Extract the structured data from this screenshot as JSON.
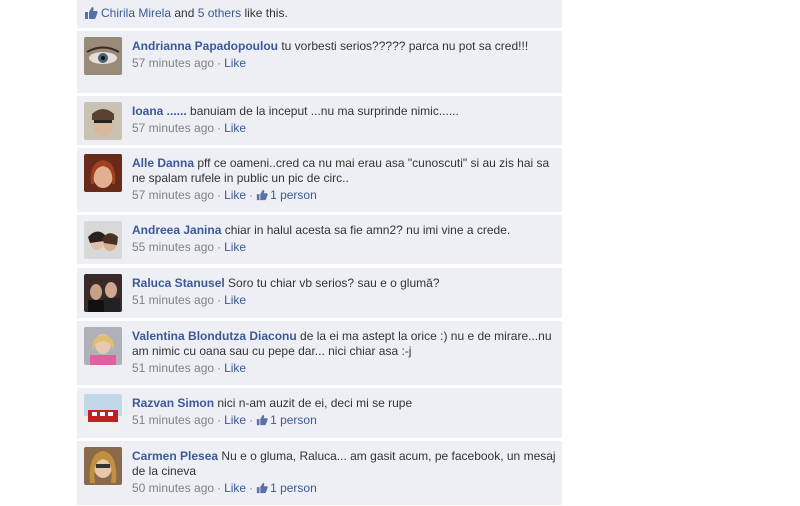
{
  "likes_bar": {
    "name": "Chirila Mirela",
    "and": "and",
    "others": "5 others",
    "suffix": "like this."
  },
  "comments": [
    {
      "author": "Andrianna Papadopoulou",
      "text": "tu vorbesti serios????? parca nu pot sa cred!!!",
      "time": "57 minutes ago",
      "like": "Like",
      "likes": ""
    },
    {
      "author": "Ioana ......",
      "text": "banuiam de la inceput ...nu ma surprinde nimic......",
      "time": "57 minutes ago",
      "like": "Like",
      "likes": ""
    },
    {
      "author": "Alle Danna",
      "text": "pff ce oameni..cred ca nu mai erau asa \"cunoscuti\" si au zis hai sa ne spalam rufele in public un pic de circ..",
      "time": "57 minutes ago",
      "like": "Like",
      "likes": "1 person"
    },
    {
      "author": "Andreea Janina",
      "text": "chiar in halul acesta sa fie amn2? nu imi vine a crede.",
      "time": "55 minutes ago",
      "like": "Like",
      "likes": ""
    },
    {
      "author": "Raluca Stanusel",
      "text": "Soro tu chiar vb serios? sau e o glumă?",
      "time": "51 minutes ago",
      "like": "Like",
      "likes": ""
    },
    {
      "author": "Valentina Blondutza Diaconu",
      "text": "de la ei ma astept la orice :) nu e de mirare...nu am nimic cu oana sau cu pepe dar... nici chiar asa :-j",
      "time": "51 minutes ago",
      "like": "Like",
      "likes": ""
    },
    {
      "author": "Razvan Simon",
      "text": "nici n-am auzit de ei, deci mi se rupe",
      "time": "51 minutes ago",
      "like": "Like",
      "likes": "1 person"
    },
    {
      "author": "Carmen Plesea",
      "text": "Nu e o gluma, Raluca... am gasit acum, pe facebook, un mesaj de la cineva",
      "time": "50 minutes ago",
      "like": "Like",
      "likes": "1 person"
    }
  ],
  "colors": {
    "link": "#3b5998",
    "bg": "#edeff4",
    "meta": "#808080"
  }
}
